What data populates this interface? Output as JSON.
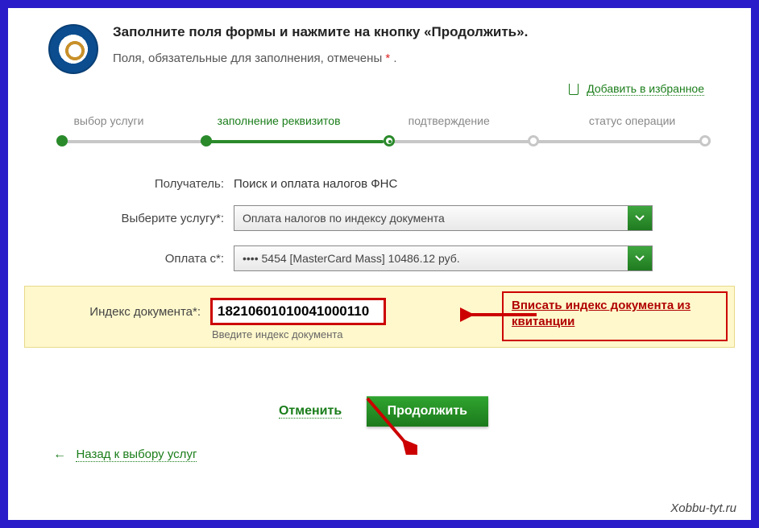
{
  "header": {
    "title": "Заполните поля формы и нажмите на кнопку «Продолжить».",
    "subtitle_prefix": "Поля, обязательные для заполнения, отмечены ",
    "subtitle_suffix": " .",
    "asterisk": "*"
  },
  "favorite": {
    "label": "Добавить в избранное"
  },
  "stepper": {
    "steps": [
      {
        "label": "выбор услуги"
      },
      {
        "label": "заполнение реквизитов"
      },
      {
        "label": "подтверждение"
      },
      {
        "label": "статус операции"
      }
    ]
  },
  "form": {
    "recipient_label": "Получатель:",
    "recipient_value": "Поиск и оплата налогов ФНС",
    "service_label": "Выберите услугу*:",
    "service_value": "Оплата налогов по индексу документа",
    "payfrom_label": "Оплата с*:",
    "payfrom_value": "•••• 5454 [MasterCard Mass] 10486.12 руб.",
    "index_label": "Индекс документа*:",
    "index_value": "18210601010041000110",
    "index_hint": "Введите индекс документа"
  },
  "annotation": {
    "text": "Вписать индекс документа из квитанции"
  },
  "buttons": {
    "cancel": "Отменить",
    "continue": "Продолжить"
  },
  "back": {
    "label": "Назад к выбору услуг"
  },
  "watermark": "Xobbu-tyt.ru"
}
